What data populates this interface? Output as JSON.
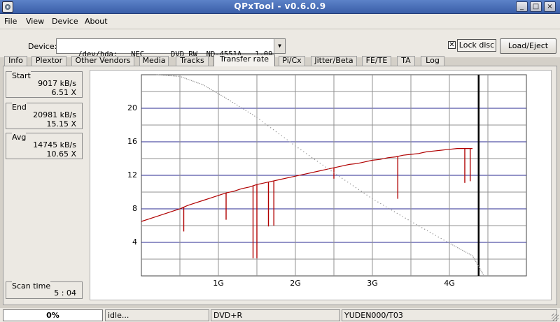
{
  "window": {
    "title": "QPxTool - v0.6.0.9",
    "controls": {
      "minimize": "_",
      "maximize": "□",
      "close": "×"
    }
  },
  "menu": [
    "File",
    "View",
    "Device",
    "About"
  ],
  "device": {
    "label": "Device:",
    "selected": "/dev/hda:  _NEC      DVD_RW  ND-4551A   1-09",
    "lock_checked": true,
    "lock_label": "Lock disc",
    "eject_label": "Load/Eject"
  },
  "tabs": [
    "Info",
    "Plextor",
    "Other Vendors",
    "Media",
    "Tracks",
    "Transfer rate",
    "Pi/Cx",
    "Jitter/Beta",
    "FE/TE",
    "TA",
    "Log"
  ],
  "active_tab": "Transfer rate",
  "stats": {
    "start": {
      "title": "Start",
      "kbs": "9017 kB/s",
      "x": "6.51 X"
    },
    "end": {
      "title": "End",
      "kbs": "20981 kB/s",
      "x": "15.15 X"
    },
    "avg": {
      "title": "Avg",
      "kbs": "14745 kB/s",
      "x": "10.65 X"
    },
    "scan_time": {
      "title": "Scan time",
      "value": "5 : 04"
    }
  },
  "chart_data": {
    "type": "line",
    "title": "",
    "xlabel": "",
    "ylabel": "",
    "x_unit": "GB",
    "xlim": [
      0,
      5
    ],
    "ylim": [
      0,
      24
    ],
    "y_ticks": [
      4,
      8,
      12,
      16,
      20
    ],
    "x_ticks": [
      {
        "v": 1,
        "label": "1G"
      },
      {
        "v": 2,
        "label": "2G"
      },
      {
        "v": 3,
        "label": "3G"
      },
      {
        "v": 4,
        "label": "4G"
      }
    ],
    "disc_end_gb": 4.38,
    "grid": true,
    "series": [
      {
        "color": "#b00000",
        "x": [
          0.0,
          0.1,
          0.2,
          0.3,
          0.4,
          0.5,
          0.55,
          0.6,
          0.7,
          0.8,
          0.9,
          1.0,
          1.1,
          1.2,
          1.3,
          1.4,
          1.5,
          1.6,
          1.7,
          1.8,
          1.9,
          2.0,
          2.1,
          2.2,
          2.3,
          2.4,
          2.5,
          2.6,
          2.7,
          2.8,
          2.9,
          3.0,
          3.1,
          3.2,
          3.3,
          3.4,
          3.5,
          3.6,
          3.7,
          3.8,
          3.9,
          4.0,
          4.1,
          4.2,
          4.3
        ],
        "values": [
          6.5,
          6.8,
          7.1,
          7.4,
          7.7,
          8.0,
          8.2,
          8.4,
          8.7,
          9.0,
          9.3,
          9.6,
          9.9,
          10.1,
          10.4,
          10.6,
          10.9,
          11.1,
          11.3,
          11.5,
          11.7,
          11.9,
          12.1,
          12.3,
          12.5,
          12.7,
          12.9,
          13.1,
          13.3,
          13.4,
          13.6,
          13.8,
          13.9,
          14.1,
          14.2,
          14.4,
          14.5,
          14.6,
          14.8,
          14.9,
          15.0,
          15.1,
          15.2,
          15.2,
          15.2
        ]
      },
      {
        "color": "#b00000",
        "x": [
          0.55,
          1.1,
          1.45,
          1.5,
          1.65,
          1.72,
          2.5,
          3.33,
          4.2,
          4.27
        ],
        "values": [
          5.3,
          6.7,
          2.1,
          2.1,
          5.9,
          6.0,
          11.6,
          9.2,
          11.1,
          11.3
        ]
      },
      {
        "color": "#909090",
        "x": [
          0.2,
          0.5,
          0.8,
          1.1,
          1.5,
          2.0,
          2.5,
          3.0,
          3.5,
          4.0,
          4.3,
          4.45
        ],
        "values": [
          24.0,
          23.8,
          22.8,
          21.2,
          18.9,
          15.5,
          12.3,
          9.2,
          6.5,
          3.9,
          2.4,
          0.0
        ]
      }
    ]
  },
  "status": {
    "progress_percent": 0,
    "progress_label": "0%",
    "state": "idle...",
    "media_type": "DVD+R",
    "media_id": "YUDEN000/T03"
  }
}
